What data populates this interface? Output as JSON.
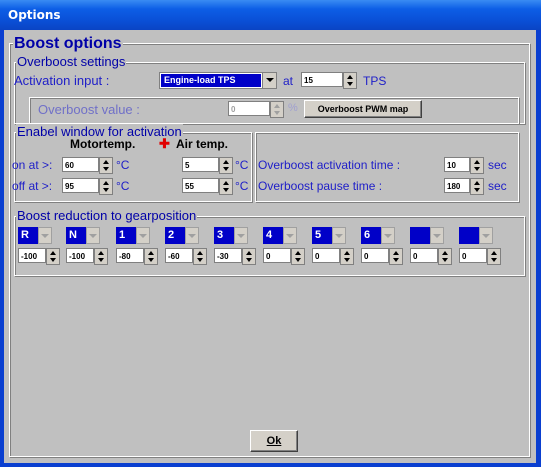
{
  "window": {
    "title": "Options"
  },
  "boost": {
    "title": "Boost options",
    "overboost": {
      "title": "Overboost settings",
      "activation_label": "Activation input :",
      "activation_value": "Engine-load TPS",
      "at_label": "at",
      "at_value": "15",
      "tps_unit": "TPS",
      "value_label": "Overboost value :",
      "value_value": "0",
      "value_unit": "%",
      "pwm_button": "Overboost PWM map"
    },
    "window_act": {
      "title": "Enabel window for activation",
      "motor_header": "Motortemp.",
      "air_header": "Air temp.",
      "plus": "✚",
      "on_label": "on at >:",
      "off_label": "off at >:",
      "on_motor": "60",
      "on_air": "5",
      "off_motor": "95",
      "off_air": "55",
      "unit": "°C"
    },
    "timing": {
      "activation_label": "Overboost activation time :",
      "activation_value": "10",
      "pause_label": "Overboost pause time :",
      "pause_value": "180",
      "unit": "sec"
    },
    "reduction": {
      "title": "Boost reduction to gearposition",
      "gears": [
        {
          "label": "R",
          "value": "-100"
        },
        {
          "label": "N",
          "value": "-100"
        },
        {
          "label": "1",
          "value": "-80"
        },
        {
          "label": "2",
          "value": "-60"
        },
        {
          "label": "3",
          "value": "-30"
        },
        {
          "label": "4",
          "value": "0"
        },
        {
          "label": "5",
          "value": "0"
        },
        {
          "label": "6",
          "value": "0"
        },
        {
          "label": "",
          "value": "0"
        },
        {
          "label": "",
          "value": "0"
        }
      ]
    }
  },
  "ok_button": "Ok"
}
